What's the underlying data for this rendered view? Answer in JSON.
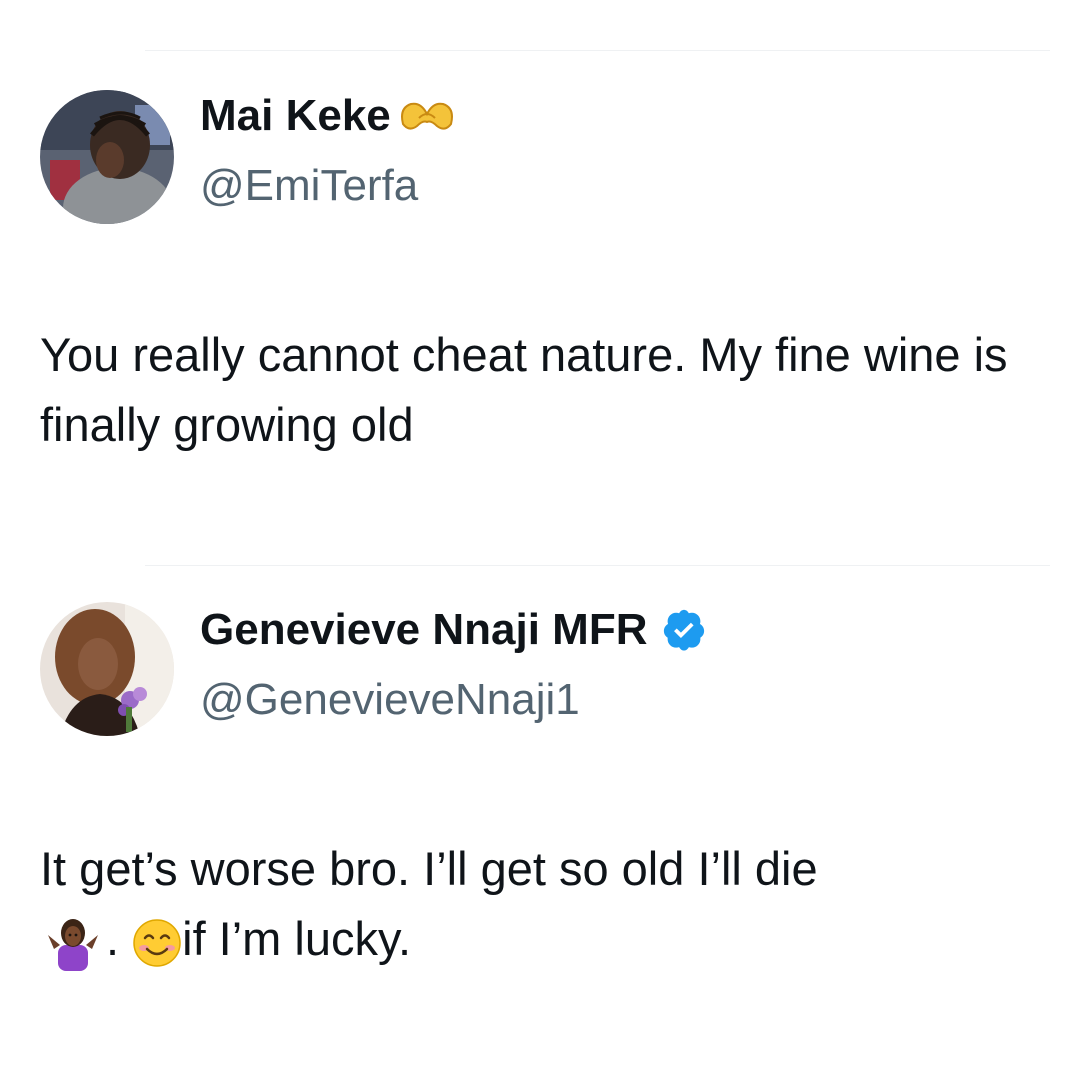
{
  "tweets": [
    {
      "display_name": "Mai Keke",
      "name_emoji_icon": "heart-hands-emoji-icon",
      "handle": "@EmiTerfa",
      "text": "You really cannot cheat nature. My fine wine is finally growing old"
    },
    {
      "display_name": "Genevieve Nnaji MFR",
      "verified_icon": "verified-badge-icon",
      "handle": "@GenevieveNnaji1",
      "text_line1": "It get’s worse bro. I’ll get so old I’ll die",
      "text_sep": ". ",
      "text_tail": "if I’m lucky.",
      "emoji_icons": [
        "woman-shrugging-emoji-icon",
        "smiling-face-emoji-icon"
      ]
    }
  ],
  "colors": {
    "text": "#0f1419",
    "handle": "#536471",
    "verified": "#1d9bf0",
    "divider": "#eff1f3"
  }
}
